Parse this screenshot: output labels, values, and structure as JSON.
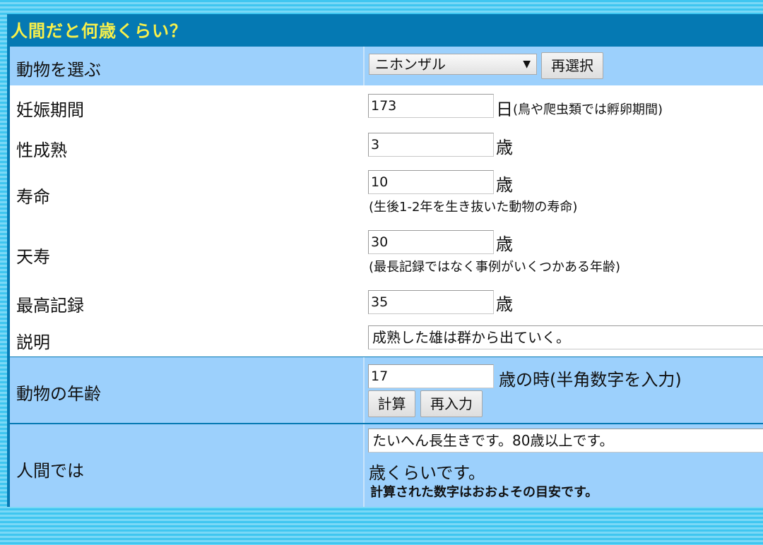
{
  "title": "人間だと何歳くらい？",
  "select_row": {
    "label": "動物を選ぶ",
    "selected": "ニホンザル",
    "arrow": "▼",
    "reselect_button": "再選択"
  },
  "fields": {
    "gestation": {
      "label": "妊娠期間",
      "value": "173",
      "unit": "日",
      "note": "(鳥や爬虫類では孵卵期間)"
    },
    "maturity": {
      "label": "性成熟",
      "value": "3",
      "unit": "歳"
    },
    "lifespan": {
      "label": "寿命",
      "value": "10",
      "unit": "歳",
      "note": "(生後1-2年を生き抜いた動物の寿命)"
    },
    "natural_life": {
      "label": "天寿",
      "value": "30",
      "unit": "歳",
      "note": "(最長記録ではなく事例がいくつかある年齢)"
    },
    "record": {
      "label": "最高記録",
      "value": "35",
      "unit": "歳"
    },
    "description": {
      "label": "説明",
      "value": "成熟した雄は群から出ていく。"
    }
  },
  "age_row": {
    "label": "動物の年齢",
    "value": "17",
    "unit": "歳の時(半角数字を入力)",
    "calc_button": "計算",
    "reenter_button": "再入力"
  },
  "result_row": {
    "label": "人間では",
    "value": "たいへん長生きです。80歳以上です。",
    "suffix": "歳くらいです。",
    "note": "計算された数字はおおよその目安です。"
  }
}
